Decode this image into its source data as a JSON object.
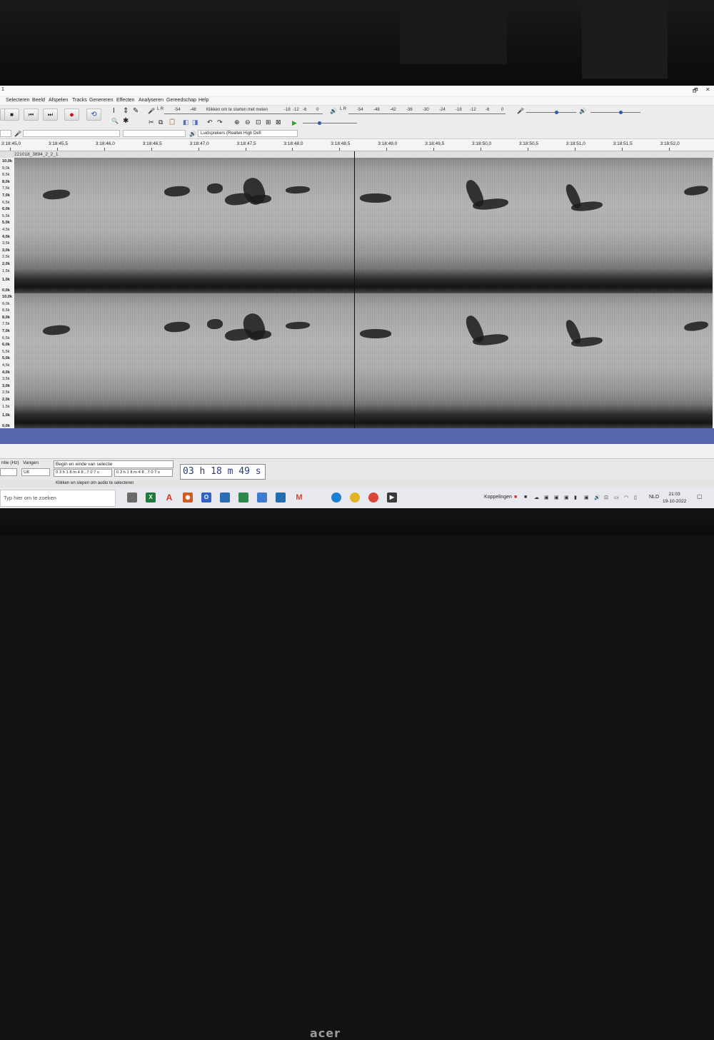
{
  "title": "1",
  "window_controls": [
    "🗗",
    "✕"
  ],
  "menu": [
    "Selecteren",
    "Beeld",
    "Afspelen",
    "Tracks",
    "Genereren",
    "Effecten",
    "Analyseren",
    "Gereedschap",
    "Help"
  ],
  "transport": {
    "pause": "⏸",
    "stop": "■",
    "skip_start": "⏮",
    "skip_end": "⏭",
    "record": "●",
    "loop": "⟲"
  },
  "tools": {
    "select": "I",
    "envelope": "⇕",
    "draw": "✎",
    "zoom": "🔍",
    "multi": "✱",
    "mic": "🎤",
    "speaker": "🔊"
  },
  "edit_icons": [
    "✂",
    "⧉",
    "📋",
    "◧",
    "◨",
    "↶",
    "↷",
    "⊕",
    "⊖",
    "⊡",
    "⊞",
    "⊠"
  ],
  "record_meter": {
    "lr": "L R",
    "ticks": [
      "-54",
      "-48"
    ],
    "hint": "Klikken om te starten met meten",
    "ticks2": [
      "-18",
      "-12",
      "-6",
      "0"
    ]
  },
  "playback_meter": {
    "lr": "L R",
    "ticks": [
      "-54",
      "-48",
      "-42",
      "-36",
      "-30",
      "-24",
      "-18",
      "-12",
      "-6",
      "0"
    ]
  },
  "device": {
    "output": "Luidsprekers (Realtek High Defi",
    "play_at_speed": "▶"
  },
  "sliders": {
    "record_volume": 0.6,
    "playback_volume": 0.6,
    "speed": 0.3
  },
  "ruler": {
    "labels": [
      "3:18:45,0",
      "3:18:45,5",
      "3:18:46,0",
      "3:18:46,5",
      "3:18:47,0",
      "3:18:47,5",
      "3:18:48,0",
      "3:18:48,5",
      "3:18:49,0",
      "3:18:49,5",
      "3:18:50,0",
      "3:18:50,5",
      "3:18:51,0",
      "3:18:51,5",
      "3:18:52,0"
    ]
  },
  "track": {
    "name": "221018_3894_2_2_1",
    "yaxis": [
      "10,0k",
      "9,0k",
      "8,5k",
      "8,0k",
      "7,5k",
      "7,0k",
      "6,5k",
      "6,0k",
      "5,5k",
      "5,0k",
      "4,5k",
      "4,0k",
      "3,5k",
      "3,0k",
      "2,5k",
      "2,0k",
      "1,5k",
      "1,0k",
      "0,0k"
    ]
  },
  "selection": {
    "rate_label": "ntie (Hz)",
    "snap_label": "Vangen",
    "snap_value": "Uit",
    "mode": "Begin en einde van selectie",
    "start": "0 3 h 1 8 m 4 8 , 7 0 7 s",
    "end": "0 3 h 1 8 m 4 8 , 7 0 7 s",
    "position": "03 h 18 m 49 s"
  },
  "status": "Klikken en slepen om audio te selecteren",
  "taskbar": {
    "search": "Typ hier om te zoeken",
    "links": "Koppelingen",
    "lang": "NLD",
    "time": "21:03",
    "date": "19-10-2022"
  },
  "brand": "acer"
}
